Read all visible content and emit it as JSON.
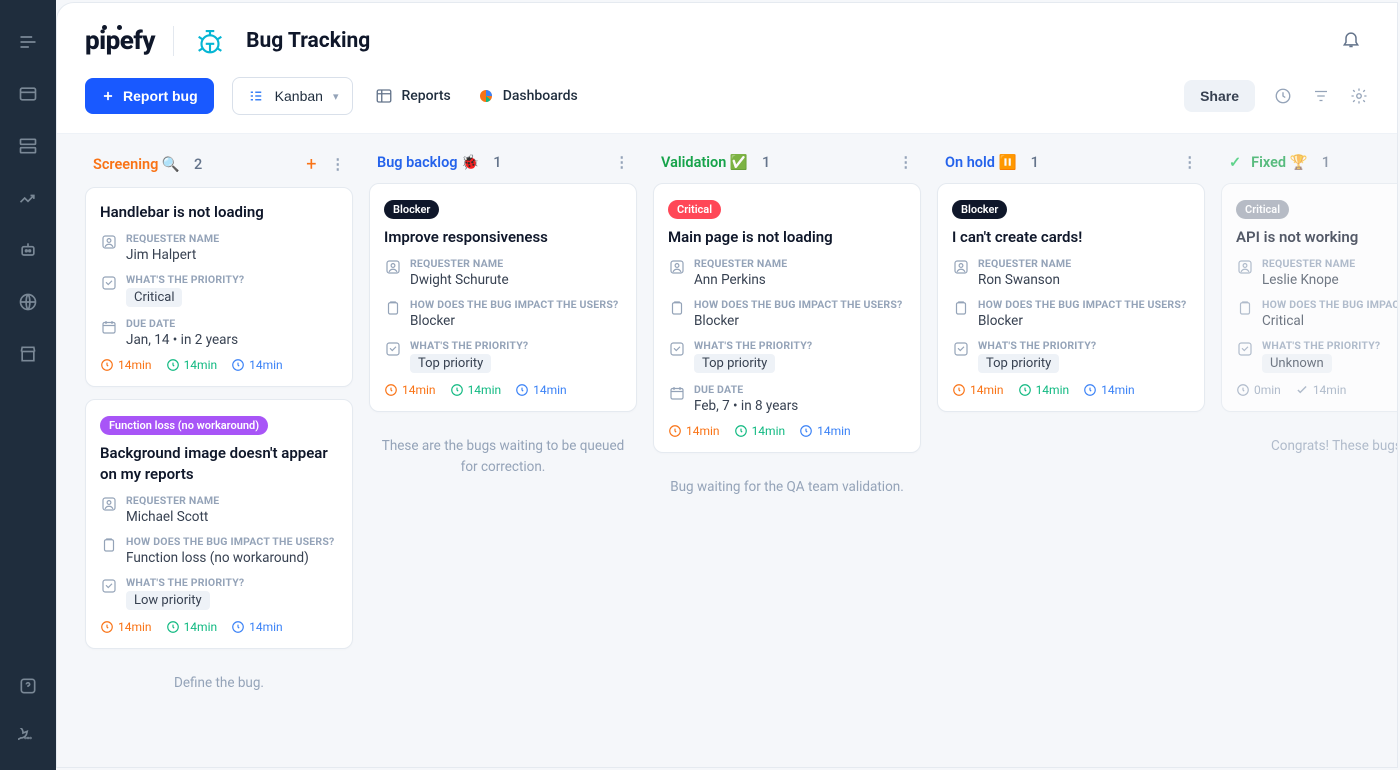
{
  "app": {
    "logo_text": "pipefy",
    "pipe_title": "Bug Tracking"
  },
  "toolbar": {
    "report_label": "Report bug",
    "kanban_label": "Kanban",
    "reports_label": "Reports",
    "dashboards_label": "Dashboards",
    "share_label": "Share"
  },
  "labels": {
    "requester": "REQUESTER NAME",
    "priority": "WHAT'S THE PRIORITY?",
    "impact": "HOW DOES THE BUG IMPACT THE USERS?",
    "due": "DUE DATE"
  },
  "columns": [
    {
      "title": "Screening 🔍",
      "title_class": "screening-t",
      "count": "2",
      "show_add": true,
      "hint": "Define the bug.",
      "cards": [
        {
          "title": "Handlebar is not loading",
          "requester": "Jim Halpert",
          "priority_chip": "Critical",
          "due": "Jan, 14 • in 2 years",
          "timers": [
            "14min",
            "14min",
            "14min"
          ]
        },
        {
          "tag": {
            "label": "Function loss (no workaround)",
            "class": "tag-funcloss"
          },
          "title": "Background image doesn't appear on my reports",
          "requester": "Michael Scott",
          "impact": "Function loss (no workaround)",
          "priority_chip": "Low priority",
          "timers": [
            "14min",
            "14min",
            "14min"
          ]
        }
      ]
    },
    {
      "title": "Bug backlog 🐞",
      "title_class": "backlog-t",
      "count": "1",
      "hint": "These are the bugs waiting to be queued for correction.",
      "cards": [
        {
          "tag": {
            "label": "Blocker",
            "class": "tag-blocker"
          },
          "title": "Improve responsiveness",
          "requester": "Dwight Schurute",
          "impact": "Blocker",
          "priority_chip": "Top priority",
          "timers": [
            "14min",
            "14min",
            "14min"
          ]
        }
      ]
    },
    {
      "title": "Validation ✅",
      "title_class": "validation-t",
      "count": "1",
      "hint": "Bug waiting for the QA team validation.",
      "cards": [
        {
          "tag": {
            "label": "Critical",
            "class": "tag-critical"
          },
          "title": "Main page is not loading",
          "requester": "Ann Perkins",
          "impact": "Blocker",
          "priority_chip": "Top priority",
          "due": "Feb, 7 • in 8 years",
          "timers": [
            "14min",
            "14min",
            "14min"
          ]
        }
      ]
    },
    {
      "title": "On hold ⏸️",
      "title_class": "onhold-t",
      "count": "1",
      "cards": [
        {
          "tag": {
            "label": "Blocker",
            "class": "tag-blocker"
          },
          "title": "I can't create cards!",
          "requester": "Ron Swanson",
          "impact": "Blocker",
          "priority_chip": "Top priority",
          "timers": [
            "14min",
            "14min",
            "14min"
          ]
        }
      ]
    },
    {
      "title": "Fixed 🏆",
      "title_class": "fixed-t",
      "count": "1",
      "is_fixed": true,
      "hint": "Congrats! These bugs are sr",
      "cards": [
        {
          "tag": {
            "label": "Critical",
            "class": "tag-critical-muted"
          },
          "title": "API is not working",
          "requester": "Leslie Knope",
          "impact": "Critical",
          "priority_chip": "Unknown",
          "timers_done": [
            "0min",
            "14min"
          ]
        }
      ]
    }
  ]
}
